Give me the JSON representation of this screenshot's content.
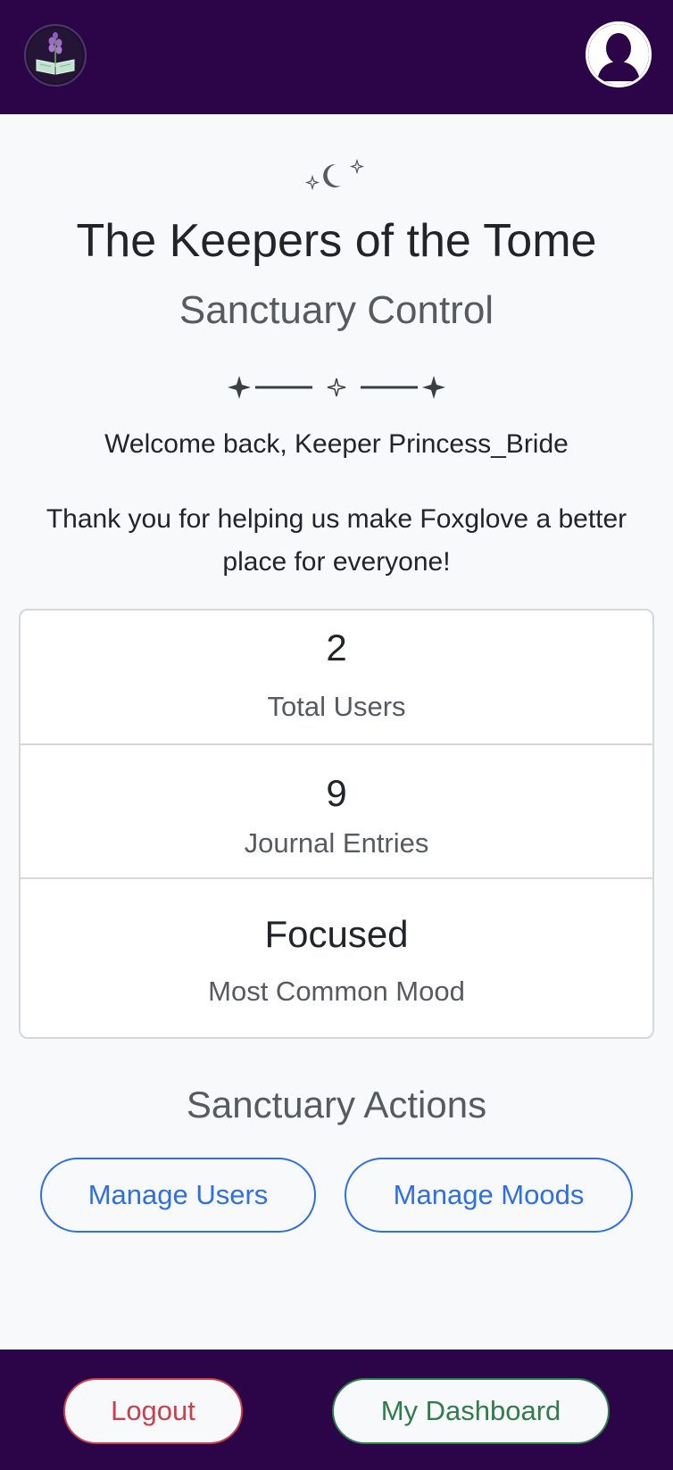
{
  "header": {
    "logo_icon": "foxglove-tome-logo-icon",
    "avatar_icon": "user-avatar-icon"
  },
  "hero": {
    "moon_icon": "moon-stars-icon",
    "title": "The Keepers of the Tome",
    "subtitle": "Sanctuary Control",
    "divider_icon": "star-divider-icon",
    "welcome": "Welcome back, Keeper Princess_Bride",
    "thanks": "Thank you for helping us make Foxglove a better place for everyone!"
  },
  "stats": [
    {
      "value": "2",
      "label": "Total Users"
    },
    {
      "value": "9",
      "label": "Journal Entries"
    },
    {
      "value": "Focused",
      "label": "Most Common Mood"
    }
  ],
  "actions": {
    "heading": "Sanctuary Actions",
    "manage_users": "Manage Users",
    "manage_moods": "Manage Moods"
  },
  "footer": {
    "logout": "Logout",
    "dashboard": "My Dashboard"
  },
  "colors": {
    "nav_bg": "#2b0547",
    "page_bg": "#f8f9fa",
    "primary": "#2f6fe4",
    "danger": "#c8414b",
    "success": "#2f7d4a"
  }
}
